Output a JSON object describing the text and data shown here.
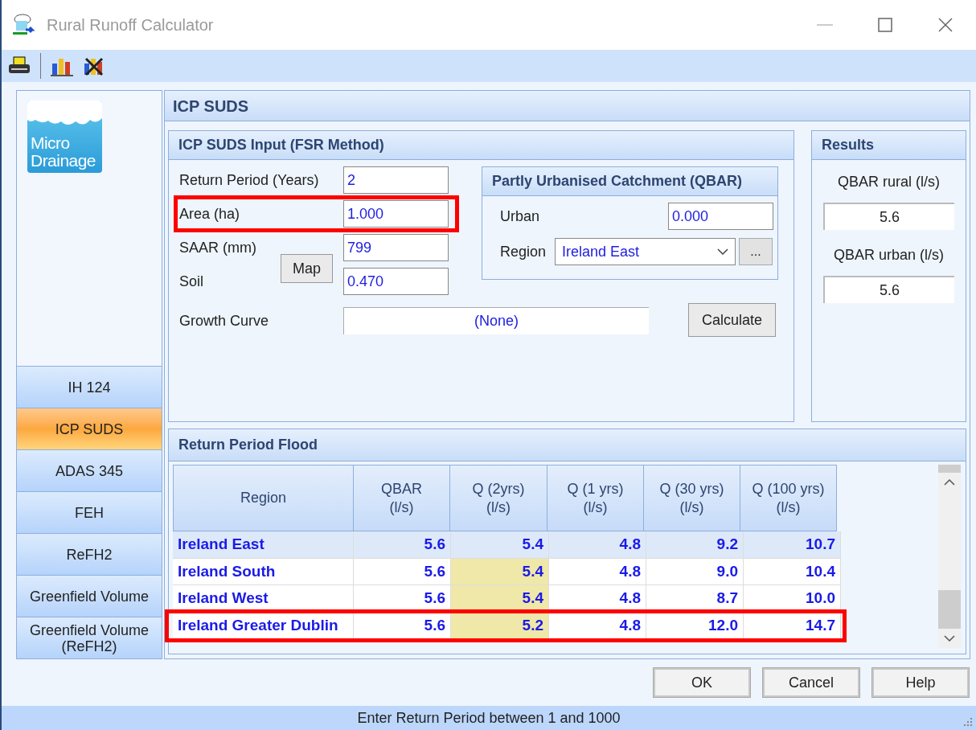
{
  "window": {
    "title": "Rural Runoff Calculator"
  },
  "logo": {
    "lines": [
      "Micro",
      "Drainage"
    ]
  },
  "sidebar": {
    "items": [
      {
        "label": "IH 124",
        "selected": false
      },
      {
        "label": "ICP SUDS",
        "selected": true
      },
      {
        "label": "ADAS 345",
        "selected": false
      },
      {
        "label": "FEH",
        "selected": false
      },
      {
        "label": "ReFH2",
        "selected": false
      },
      {
        "label": "Greenfield Volume",
        "selected": false
      },
      {
        "label": "Greenfield Volume (ReFH2)",
        "selected": false
      }
    ]
  },
  "page_title": "ICP SUDS",
  "input_group": {
    "title": "ICP SUDS Input (FSR Method)",
    "fields": [
      {
        "label": "Return Period (Years)",
        "value": "2",
        "highlighted": false
      },
      {
        "label": "Area (ha)",
        "value": "1.000",
        "highlighted": true
      },
      {
        "label": "SAAR (mm)",
        "value": "799",
        "highlighted": false
      },
      {
        "label": "Soil",
        "value": "0.470",
        "highlighted": false
      }
    ],
    "map_button": "Map",
    "growth_curve": {
      "label": "Growth Curve",
      "value": "(None)"
    },
    "calculate_button": "Calculate"
  },
  "urban_group": {
    "title": "Partly Urbanised Catchment (QBAR)",
    "urban_label": "Urban",
    "urban_value": "0.000",
    "region_label": "Region",
    "region_value": "Ireland East",
    "browse_button": "..."
  },
  "results": {
    "title": "Results",
    "items": [
      {
        "label": "QBAR rural (l/s)",
        "value": "5.6"
      },
      {
        "label": "QBAR urban (l/s)",
        "value": "5.6"
      }
    ]
  },
  "flood": {
    "title": "Return Period Flood",
    "columns": [
      "Region",
      "QBAR\n(l/s)",
      "Q (2yrs)\n(l/s)",
      "Q (1 yrs)\n(l/s)",
      "Q (30 yrs)\n(l/s)",
      "Q (100 yrs)\n(l/s)"
    ],
    "rows": [
      {
        "selected": true,
        "highlighted": false,
        "cells": [
          {
            "text": "Ireland East",
            "shaded": false
          },
          {
            "text": "5.6",
            "shaded": false
          },
          {
            "text": "5.4",
            "shaded": false
          },
          {
            "text": "4.8",
            "shaded": false
          },
          {
            "text": "9.2",
            "shaded": false
          },
          {
            "text": "10.7",
            "shaded": false
          }
        ]
      },
      {
        "selected": false,
        "highlighted": false,
        "cells": [
          {
            "text": "Ireland South",
            "shaded": false
          },
          {
            "text": "5.6",
            "shaded": false
          },
          {
            "text": "5.4",
            "shaded": true
          },
          {
            "text": "4.8",
            "shaded": false
          },
          {
            "text": "9.0",
            "shaded": false
          },
          {
            "text": "10.4",
            "shaded": false
          }
        ]
      },
      {
        "selected": false,
        "highlighted": false,
        "cells": [
          {
            "text": "Ireland West",
            "shaded": false
          },
          {
            "text": "5.6",
            "shaded": false
          },
          {
            "text": "5.4",
            "shaded": true
          },
          {
            "text": "4.8",
            "shaded": false
          },
          {
            "text": "8.7",
            "shaded": false
          },
          {
            "text": "10.0",
            "shaded": false
          }
        ]
      },
      {
        "selected": false,
        "highlighted": true,
        "cells": [
          {
            "text": "Ireland Greater Dublin",
            "shaded": false
          },
          {
            "text": "5.6",
            "shaded": false
          },
          {
            "text": "5.2",
            "shaded": true
          },
          {
            "text": "4.8",
            "shaded": false
          },
          {
            "text": "12.0",
            "shaded": false
          },
          {
            "text": "14.7",
            "shaded": false
          }
        ]
      }
    ]
  },
  "buttons": [
    "OK",
    "Cancel",
    "Help"
  ],
  "status_bar": "Enter Return Period between 1 and 1000"
}
